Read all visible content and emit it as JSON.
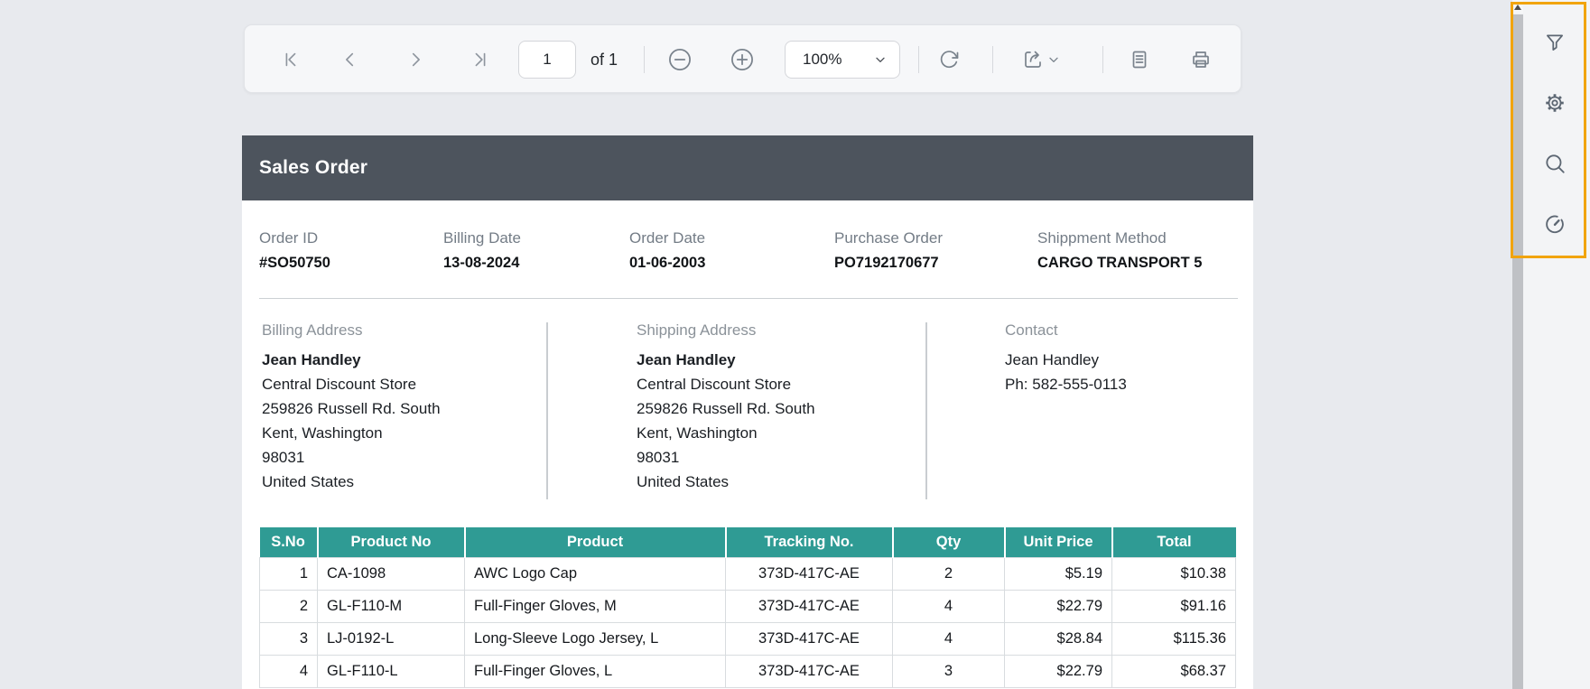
{
  "toolbar": {
    "page_input_value": "1",
    "page_count_label": "of 1",
    "zoom_value": "100%",
    "icons": [
      "first-page",
      "previous-page",
      "next-page",
      "last-page",
      "zoom-out",
      "zoom-in",
      "zoom-dropdown",
      "refresh",
      "export",
      "export-dropdown",
      "document",
      "print"
    ]
  },
  "side_panel": {
    "icons": [
      "filter",
      "settings",
      "search",
      "performance-gauge"
    ],
    "highlight_color": "#f1a40e"
  },
  "report": {
    "title": "Sales Order",
    "order_info": [
      {
        "label": "Order ID",
        "value": "#SO50750"
      },
      {
        "label": "Billing Date",
        "value": "13-08-2024"
      },
      {
        "label": "Order Date",
        "value": "01-06-2003"
      },
      {
        "label": "Purchase Order",
        "value": "PO7192170677"
      },
      {
        "label": "Shippment Method",
        "value": "CARGO TRANSPORT 5"
      }
    ],
    "billing_address": {
      "label": "Billing Address",
      "name": "Jean Handley",
      "lines": [
        "Central Discount Store",
        "259826 Russell Rd. South",
        "Kent, Washington",
        "98031",
        "United States"
      ]
    },
    "shipping_address": {
      "label": "Shipping Address",
      "name": "Jean Handley",
      "lines": [
        "Central Discount Store",
        "259826 Russell Rd. South",
        "Kent, Washington",
        "98031",
        "United States"
      ]
    },
    "contact": {
      "label": "Contact",
      "lines": [
        "Jean Handley",
        "Ph: 582-555-0113"
      ]
    },
    "table": {
      "headers": [
        "S.No",
        "Product No",
        "Product",
        "Tracking No.",
        "Qty",
        "Unit Price",
        "Total"
      ],
      "rows": [
        [
          "1",
          "CA-1098",
          "AWC Logo Cap",
          "373D-417C-AE",
          "2",
          "$5.19",
          "$10.38"
        ],
        [
          "2",
          "GL-F110-M",
          "Full-Finger Gloves, M",
          "373D-417C-AE",
          "4",
          "$22.79",
          "$91.16"
        ],
        [
          "3",
          "LJ-0192-L",
          "Long-Sleeve Logo Jersey, L",
          "373D-417C-AE",
          "4",
          "$28.84",
          "$115.36"
        ],
        [
          "4",
          "GL-F110-L",
          "Full-Finger Gloves, L",
          "373D-417C-AE",
          "3",
          "$22.79",
          "$68.37"
        ]
      ]
    }
  },
  "colors": {
    "app_background": "#e8eaee",
    "header_bar": "#4d545d",
    "table_header_teal": "#2f9b94",
    "highlight_orange": "#f1a40e"
  }
}
